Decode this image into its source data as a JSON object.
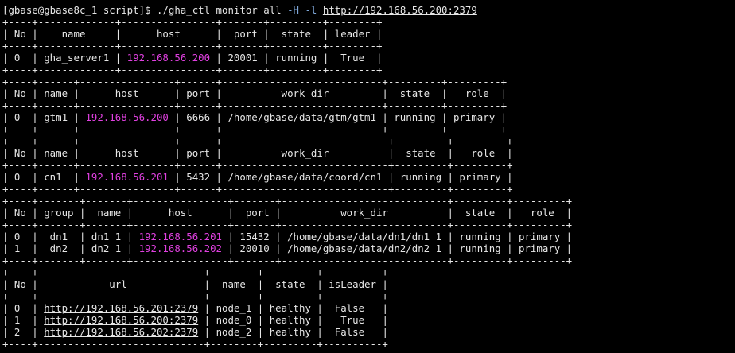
{
  "terminal": {
    "lines": [
      [
        {
          "t": "[gbase@gbase8c_1 script]$ ./gha_ctl monitor all "
        },
        {
          "t": "-H",
          "c": "flag"
        },
        {
          "t": " "
        },
        {
          "t": "-l",
          "c": "flag"
        },
        {
          "t": " "
        },
        {
          "t": "http://192.168.56.200:2379",
          "c": "url"
        }
      ],
      [
        {
          "t": "+----+-------------+----------------+-------+---------+--------+"
        }
      ],
      [
        {
          "t": "| No |    name     |      host      |  port |  state  | leader |"
        }
      ],
      [
        {
          "t": "+----+-------------+----------------+-------+---------+--------+"
        }
      ],
      [
        {
          "t": "| 0  | gha_server1 | "
        },
        {
          "t": "192.168.56.200",
          "c": "ip"
        },
        {
          "t": " | 20001 | running |  True  |"
        }
      ],
      [
        {
          "t": "+----+-------------+----------------+-------+---------+--------+"
        }
      ],
      [
        {
          "t": "+----+------+----------------+------+---------------------------+---------+---------+"
        }
      ],
      [
        {
          "t": "| No | name |      host      | port |          work_dir         |  state  |   role  |"
        }
      ],
      [
        {
          "t": "+----+------+----------------+------+---------------------------+---------+---------+"
        }
      ],
      [
        {
          "t": "| 0  | gtm1 | "
        },
        {
          "t": "192.168.56.200",
          "c": "ip"
        },
        {
          "t": " | 6666 | /home/gbase/data/gtm/gtm1 | running | primary |"
        }
      ],
      [
        {
          "t": "+----+------+----------------+------+---------------------------+---------+---------+"
        }
      ],
      [
        {
          "t": "+----+------+----------------+------+----------------------------+---------+---------+"
        }
      ],
      [
        {
          "t": "| No | name |      host      | port |          work_dir          |  state  |   role  |"
        }
      ],
      [
        {
          "t": "+----+------+----------------+------+----------------------------+---------+---------+"
        }
      ],
      [
        {
          "t": "| 0  | cn1  | "
        },
        {
          "t": "192.168.56.201",
          "c": "ip"
        },
        {
          "t": " | 5432 | /home/gbase/data/coord/cn1 | running | primary |"
        }
      ],
      [
        {
          "t": "+----+------+----------------+------+----------------------------+---------+---------+"
        }
      ],
      [
        {
          "t": "+----+-------+-------+----------------+-------+----------------------------+---------+---------+"
        }
      ],
      [
        {
          "t": "| No | group |  name |      host      |  port |          work_dir          |  state  |   role  |"
        }
      ],
      [
        {
          "t": "+----+-------+-------+----------------+-------+----------------------------+---------+---------+"
        }
      ],
      [
        {
          "t": "| 0  |  dn1  | dn1_1 | "
        },
        {
          "t": "192.168.56.201",
          "c": "ip"
        },
        {
          "t": " | 15432 | /home/gbase/data/dn1/dn1_1 | running | primary |"
        }
      ],
      [
        {
          "t": "| 1  |  dn2  | dn2_1 | "
        },
        {
          "t": "192.168.56.202",
          "c": "ip"
        },
        {
          "t": " | 20010 | /home/gbase/data/dn2/dn2_1 | running | primary |"
        }
      ],
      [
        {
          "t": "+----+-------+-------+----------------+-------+----------------------------+---------+---------+"
        }
      ],
      [
        {
          "t": "+----+----------------------------+--------+---------+----------+"
        }
      ],
      [
        {
          "t": "| No |            url             |  name  |  state  | isLeader |"
        }
      ],
      [
        {
          "t": "+----+----------------------------+--------+---------+----------+"
        }
      ],
      [
        {
          "t": "| 0  | "
        },
        {
          "t": "http://192.168.56.201:2379",
          "c": "url"
        },
        {
          "t": " | node_1 | healthy |  False   |"
        }
      ],
      [
        {
          "t": "| 1  | "
        },
        {
          "t": "http://192.168.56.200:2379",
          "c": "url"
        },
        {
          "t": " | node_0 | healthy |   True   |"
        }
      ],
      [
        {
          "t": "| 2  | "
        },
        {
          "t": "http://192.168.56.202:2379",
          "c": "url"
        },
        {
          "t": " | node_2 | healthy |  False   |"
        }
      ],
      [
        {
          "t": "+----+----------------------------+--------+---------+----------+"
        }
      ]
    ]
  }
}
